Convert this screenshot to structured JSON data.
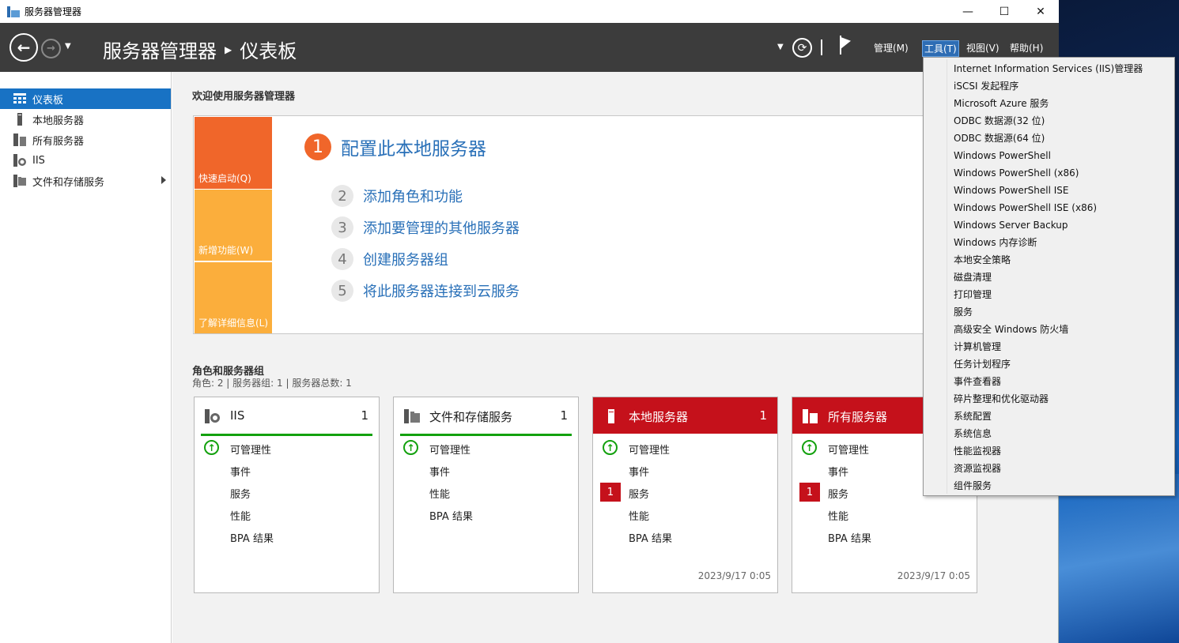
{
  "window": {
    "title": "服务器管理器",
    "controls": [
      "minimize",
      "maximize",
      "close"
    ]
  },
  "header": {
    "breadcrumb": [
      "服务器管理器",
      "仪表板"
    ],
    "menus": [
      {
        "label": "管理(M)",
        "active": false
      },
      {
        "label": "工具(T)",
        "active": true
      },
      {
        "label": "视图(V)",
        "active": false
      },
      {
        "label": "帮助(H)",
        "active": false
      }
    ],
    "icons": [
      "back-arrow-icon",
      "forward-arrow-icon",
      "refresh-icon",
      "flag-icon"
    ]
  },
  "sidebar": {
    "items": [
      {
        "label": "仪表板",
        "icon": "dashboard-icon",
        "selected": true
      },
      {
        "label": "本地服务器",
        "icon": "server-icon",
        "selected": false
      },
      {
        "label": "所有服务器",
        "icon": "servers-icon",
        "selected": false
      },
      {
        "label": "IIS",
        "icon": "iis-icon",
        "selected": false
      },
      {
        "label": "文件和存储服务",
        "icon": "folder-server-icon",
        "selected": false,
        "has_submenu": true
      }
    ]
  },
  "main": {
    "welcome_title": "欢迎使用服务器管理器",
    "quickstart": {
      "tiles": [
        {
          "label": "快速启动(Q)",
          "color": "#f0662a"
        },
        {
          "label": "新增功能(W)",
          "color": "#fbae3c"
        },
        {
          "label": "了解详细信息(L)",
          "color": "#fbae3c"
        }
      ],
      "steps": [
        {
          "num": "1",
          "label": "配置此本地服务器"
        },
        {
          "num": "2",
          "label": "添加角色和功能"
        },
        {
          "num": "3",
          "label": "添加要管理的其他服务器"
        },
        {
          "num": "4",
          "label": "创建服务器组"
        },
        {
          "num": "5",
          "label": "将此服务器连接到云服务"
        }
      ]
    },
    "roles_title": "角色和服务器组",
    "roles_subtitle": "角色: 2 | 服务器组: 1 | 服务器总数: 1",
    "cards": [
      {
        "name": "IIS",
        "count": "1",
        "alert": false,
        "rows": [
          "可管理性",
          "事件",
          "服务",
          "性能",
          "BPA 结果"
        ],
        "service_badge": "",
        "time": ""
      },
      {
        "name": "文件和存储服务",
        "count": "1",
        "alert": false,
        "rows": [
          "可管理性",
          "事件",
          "性能",
          "BPA 结果"
        ],
        "service_badge": "",
        "time": ""
      },
      {
        "name": "本地服务器",
        "count": "1",
        "alert": true,
        "rows": [
          "可管理性",
          "事件",
          "服务",
          "性能",
          "BPA 结果"
        ],
        "service_badge": "1",
        "time": "2023/9/17 0:05"
      },
      {
        "name": "所有服务器",
        "count": "1",
        "alert": true,
        "rows": [
          "可管理性",
          "事件",
          "服务",
          "性能",
          "BPA 结果"
        ],
        "service_badge": "1",
        "time": "2023/9/17 0:05"
      }
    ]
  },
  "tools_menu": {
    "items": [
      "Internet Information Services (IIS)管理器",
      "iSCSI 发起程序",
      "Microsoft Azure 服务",
      "ODBC 数据源(32 位)",
      "ODBC 数据源(64 位)",
      "Windows PowerShell",
      "Windows PowerShell (x86)",
      "Windows PowerShell ISE",
      "Windows PowerShell ISE (x86)",
      "Windows Server Backup",
      "Windows 内存诊断",
      "本地安全策略",
      "磁盘清理",
      "打印管理",
      "服务",
      "高级安全 Windows 防火墙",
      "计算机管理",
      "任务计划程序",
      "事件查看器",
      "碎片整理和优化驱动器",
      "系统配置",
      "系统信息",
      "性能监视器",
      "资源监视器",
      "组件服务"
    ]
  },
  "colors": {
    "header_bg": "#3c3c3c",
    "selected_blue": "#1872c4",
    "alert_red": "#c5111b",
    "ok_green": "#13a10e",
    "quickstart_orange": "#f0662a",
    "link_blue": "#2970b8"
  }
}
